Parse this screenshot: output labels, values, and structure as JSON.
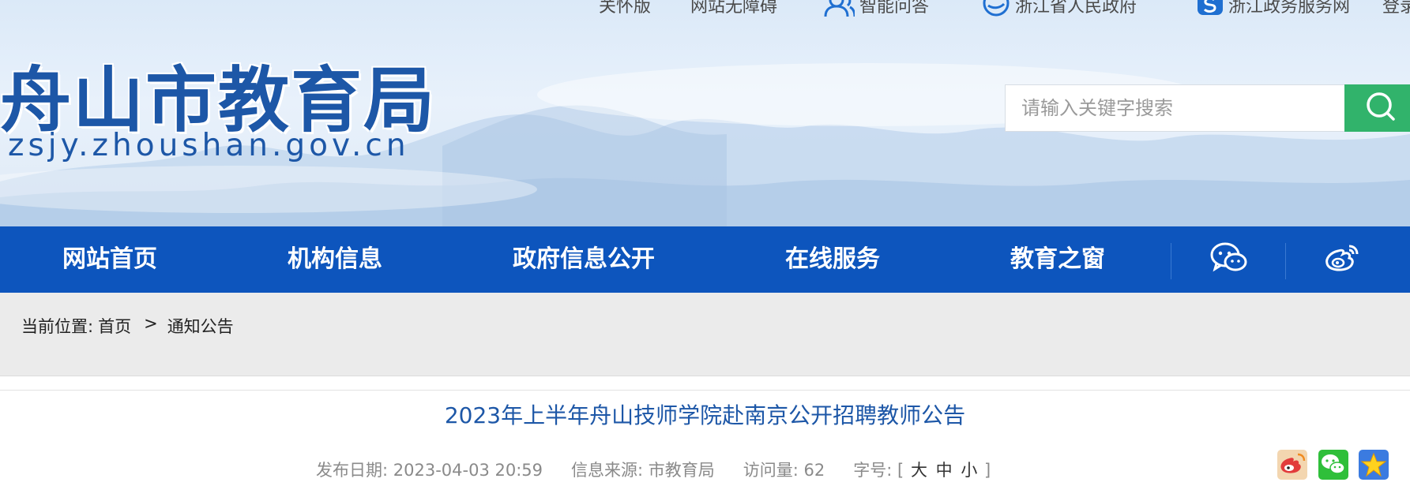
{
  "header": {
    "top_links": [
      {
        "label": "关怀版",
        "icon": "none"
      },
      {
        "label": "网站无障碍",
        "icon": "none"
      },
      {
        "label": "智能问答",
        "icon": "user-group-icon"
      },
      {
        "label": "浙江省人民政府",
        "icon": "zhejiang-gov-icon"
      },
      {
        "label": "浙江政务服务网",
        "icon": "zhejiang-service-icon"
      },
      {
        "label": "登录",
        "icon": "none"
      }
    ],
    "logo_cn": "舟山市教育局",
    "logo_en": "zsjy.zhoushan.gov.cn",
    "search_placeholder": "请输入关键字搜索",
    "search_icon": "search-icon"
  },
  "nav": {
    "items": [
      "网站首页",
      "机构信息",
      "政府信息公开",
      "在线服务",
      "教育之窗"
    ],
    "icons": [
      "wechat-icon",
      "weibo-icon"
    ]
  },
  "breadcrumb": {
    "prefix": "当前位置:",
    "home": "首页",
    "separator": ">",
    "current": "通知公告"
  },
  "article": {
    "title": "2023年上半年舟山技师学院赴南京公开招聘教师公告",
    "publish_date_label": "发布日期:",
    "publish_date": "2023-04-03 20:59",
    "source_label": "信息来源:",
    "source": "市教育局",
    "views_label": "访问量:",
    "views": "62",
    "font_size_label": "字号:",
    "font_size_open": "[",
    "font_size_options": [
      "大",
      "中",
      "小"
    ],
    "font_size_close": "]",
    "share_icons": [
      "weibo-share-icon",
      "wechat-share-icon",
      "favorite-star-icon"
    ]
  },
  "colors": {
    "nav_bg": "#0d55bd",
    "brand_blue": "#1d57a7",
    "search_green": "#31b36b",
    "breadcrumb_bg": "#ebebeb"
  }
}
